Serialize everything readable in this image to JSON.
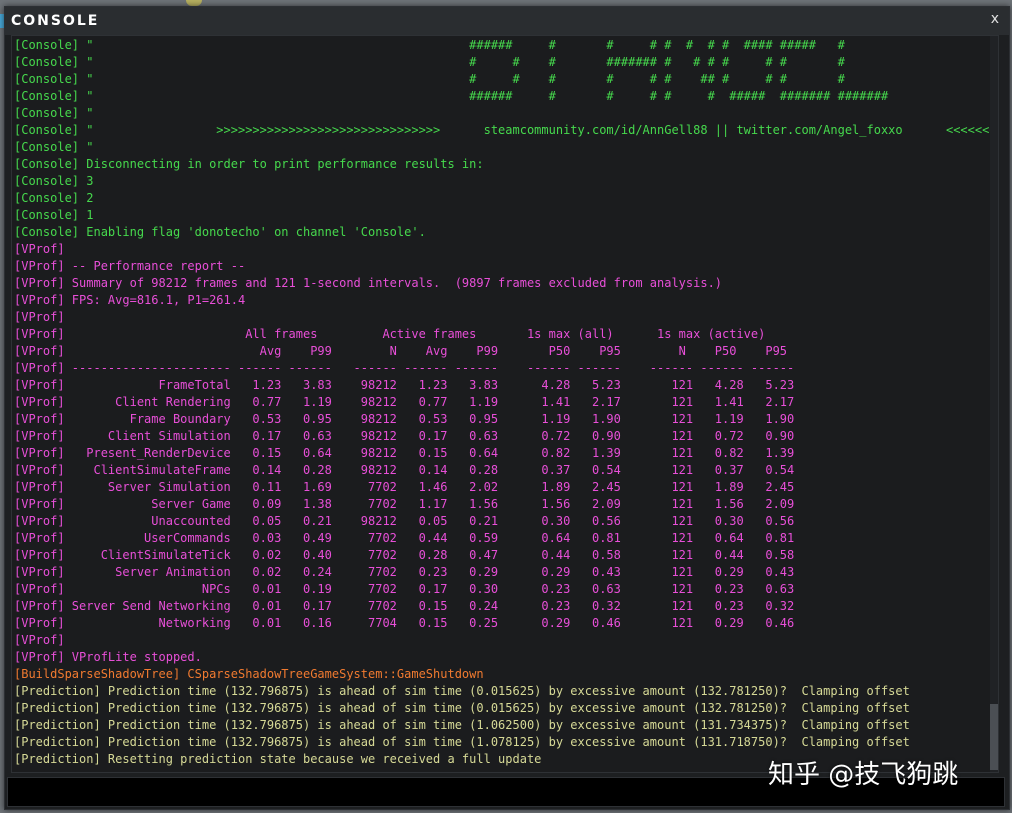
{
  "window": {
    "title": "CONSOLE",
    "close_label": "x"
  },
  "colors": {
    "console": "#46d94d",
    "vprof": "#e84fd8",
    "buildshadow": "#f07a30",
    "prediction": "#d6d996"
  },
  "lines": [
    {
      "type": "console",
      "text": "[Console] \"                                                    ######     #       #     # #  #  # #  #### #####   #"
    },
    {
      "type": "console",
      "text": "[Console] \"                                                    #     #    #       ####### #   # # #     # #       #"
    },
    {
      "type": "console",
      "text": "[Console] \"                                                    #     #    #       #     # #    ## #     # #       #"
    },
    {
      "type": "console",
      "text": "[Console] \"                                                    ######     #       #     # #     #  #####  ####### #######"
    },
    {
      "type": "console",
      "text": "[Console] \""
    },
    {
      "type": "console",
      "text": "[Console] \"                 >>>>>>>>>>>>>>>>>>>>>>>>>>>>>>>      steamcommunity.com/id/AnnGell88 || twitter.com/Angel_foxxo      <<<<<<<<<<<<<<<<<<<<<<<<<<<<<<<"
    },
    {
      "type": "console",
      "text": "[Console] \""
    },
    {
      "type": "console",
      "text": "[Console] Disconnecting in order to print performance results in:"
    },
    {
      "type": "console",
      "text": "[Console] 3"
    },
    {
      "type": "console",
      "text": "[Console] 2"
    },
    {
      "type": "console",
      "text": "[Console] 1"
    },
    {
      "type": "console",
      "text": "[Console] Enabling flag 'donotecho' on channel 'Console'."
    },
    {
      "type": "vprof",
      "text": "[VProf]"
    },
    {
      "type": "vprof",
      "text": "[VProf] -- Performance report --"
    },
    {
      "type": "vprof",
      "text": "[VProf] Summary of 98212 frames and 121 1-second intervals.  (9897 frames excluded from analysis.)"
    },
    {
      "type": "vprof",
      "text": "[VProf] FPS: Avg=816.1, P1=261.4"
    },
    {
      "type": "vprof",
      "text": "[VProf]"
    },
    {
      "type": "vprof",
      "text": "[VProf]                         All frames         Active frames       1s max (all)      1s max (active)"
    },
    {
      "type": "vprof",
      "text": "[VProf]                           Avg    P99        N    Avg    P99       P50    P95        N    P50    P95"
    },
    {
      "type": "vprof",
      "text": "[VProf] ---------------------- ------ ------   ------ ------ ------    ------ ------    ------ ------ ------"
    },
    {
      "type": "vprof",
      "text": "[VProf]             FrameTotal   1.23   3.83    98212   1.23   3.83      4.28   5.23       121   4.28   5.23"
    },
    {
      "type": "vprof",
      "text": "[VProf]       Client Rendering   0.77   1.19    98212   0.77   1.19      1.41   2.17       121   1.41   2.17"
    },
    {
      "type": "vprof",
      "text": "[VProf]         Frame Boundary   0.53   0.95    98212   0.53   0.95      1.19   1.90       121   1.19   1.90"
    },
    {
      "type": "vprof",
      "text": "[VProf]      Client Simulation   0.17   0.63    98212   0.17   0.63      0.72   0.90       121   0.72   0.90"
    },
    {
      "type": "vprof",
      "text": "[VProf]   Present_RenderDevice   0.15   0.64    98212   0.15   0.64      0.82   1.39       121   0.82   1.39"
    },
    {
      "type": "vprof",
      "text": "[VProf]    ClientSimulateFrame   0.14   0.28    98212   0.14   0.28      0.37   0.54       121   0.37   0.54"
    },
    {
      "type": "vprof",
      "text": "[VProf]      Server Simulation   0.11   1.69     7702   1.46   2.02      1.89   2.45       121   1.89   2.45"
    },
    {
      "type": "vprof",
      "text": "[VProf]            Server Game   0.09   1.38     7702   1.17   1.56      1.56   2.09       121   1.56   2.09"
    },
    {
      "type": "vprof",
      "text": "[VProf]            Unaccounted   0.05   0.21    98212   0.05   0.21      0.30   0.56       121   0.30   0.56"
    },
    {
      "type": "vprof",
      "text": "[VProf]           UserCommands   0.03   0.49     7702   0.44   0.59      0.64   0.81       121   0.64   0.81"
    },
    {
      "type": "vprof",
      "text": "[VProf]     ClientSimulateTick   0.02   0.40     7702   0.28   0.47      0.44   0.58       121   0.44   0.58"
    },
    {
      "type": "vprof",
      "text": "[VProf]       Server Animation   0.02   0.24     7702   0.23   0.29      0.29   0.43       121   0.29   0.43"
    },
    {
      "type": "vprof",
      "text": "[VProf]                   NPCs   0.01   0.19     7702   0.17   0.30      0.23   0.63       121   0.23   0.63"
    },
    {
      "type": "vprof",
      "text": "[VProf] Server Send Networking   0.01   0.17     7702   0.15   0.24      0.23   0.32       121   0.23   0.32"
    },
    {
      "type": "vprof",
      "text": "[VProf]             Networking   0.01   0.16     7704   0.15   0.25      0.29   0.46       121   0.29   0.46"
    },
    {
      "type": "vprof",
      "text": "[VProf]"
    },
    {
      "type": "vprof",
      "text": "[VProf] VProfLite stopped."
    },
    {
      "type": "build",
      "text": "[BuildSparseShadowTree] CSparseShadowTreeGameSystem::GameShutdown"
    },
    {
      "type": "pred",
      "text": "[Prediction] Prediction time (132.796875) is ahead of sim time (0.015625) by excessive amount (132.781250)?  Clamping offset"
    },
    {
      "type": "pred",
      "text": "[Prediction] Prediction time (132.796875) is ahead of sim time (0.015625) by excessive amount (132.781250)?  Clamping offset"
    },
    {
      "type": "pred",
      "text": "[Prediction] Prediction time (132.796875) is ahead of sim time (1.062500) by excessive amount (131.734375)?  Clamping offset"
    },
    {
      "type": "pred",
      "text": "[Prediction] Prediction time (132.796875) is ahead of sim time (1.078125) by excessive amount (131.718750)?  Clamping offset"
    },
    {
      "type": "pred",
      "text": "[Prediction] Resetting prediction state because we received a full update"
    }
  ],
  "input": {
    "value": ""
  },
  "watermark": "知乎 @技飞狗跳"
}
